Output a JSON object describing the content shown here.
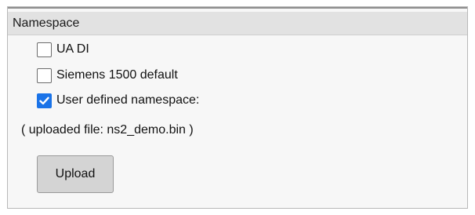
{
  "section": {
    "title": "Namespace"
  },
  "options": [
    {
      "label": "UA DI",
      "checked": false
    },
    {
      "label": "Siemens 1500 default",
      "checked": false
    },
    {
      "label": "User defined namespace:",
      "checked": true
    }
  ],
  "file_info": "( uploaded file: ns2_demo.bin )",
  "upload_button": {
    "label": "Upload"
  },
  "colors": {
    "checkbox_checked": "#1a73e8",
    "header_background": "#e2e2e2",
    "panel_background": "#f7f7f7",
    "button_background": "#d4d4d4"
  }
}
